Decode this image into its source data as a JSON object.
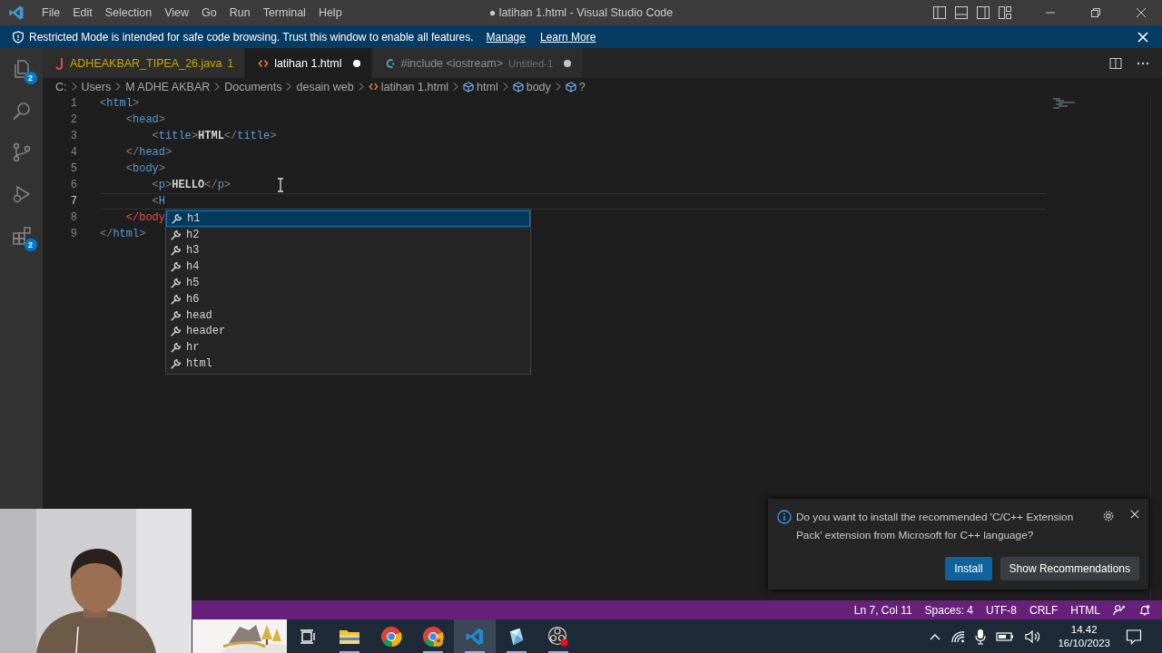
{
  "window": {
    "title": "● latihan 1.html - Visual Studio Code"
  },
  "menu": [
    "File",
    "Edit",
    "Selection",
    "View",
    "Go",
    "Run",
    "Terminal",
    "Help"
  ],
  "banner": {
    "text": "Restricted Mode is intended for safe code browsing. Trust this window to enable all features.",
    "links": [
      "Manage",
      "Learn More"
    ]
  },
  "activity_bar": [
    {
      "kind": "explorer",
      "badge": "2"
    },
    {
      "kind": "search"
    },
    {
      "kind": "source-control"
    },
    {
      "kind": "run"
    },
    {
      "kind": "extensions",
      "badge": "2"
    }
  ],
  "tabs": [
    {
      "kind": "java",
      "label": "ADHEAKBAR_TIPEA_26.java",
      "problems": "1",
      "selected": false,
      "dirty": false
    },
    {
      "kind": "html",
      "label": "latihan 1.html",
      "selected": true,
      "dirty": true
    },
    {
      "kind": "cpp",
      "label": "#include <iostream>",
      "description": "Untitled-1",
      "selected": false,
      "dirty": true
    }
  ],
  "breadcrumbs": [
    {
      "kind": "folder",
      "label": "C:"
    },
    {
      "kind": "folder",
      "label": "Users"
    },
    {
      "kind": "folder",
      "label": "M ADHE AKBAR"
    },
    {
      "kind": "folder",
      "label": "Documents"
    },
    {
      "kind": "folder",
      "label": "desain web"
    },
    {
      "kind": "file",
      "label": "latihan 1.html"
    },
    {
      "kind": "symbol",
      "label": "html"
    },
    {
      "kind": "symbol",
      "label": "body"
    },
    {
      "kind": "symbol",
      "label": "?"
    }
  ],
  "editor": {
    "lines": [
      {
        "number": "1",
        "current": false,
        "tokens": [
          {
            "kind": "punct",
            "text": "<"
          },
          {
            "kind": "tag",
            "text": "html"
          },
          {
            "kind": "punct",
            "text": ">"
          }
        ]
      },
      {
        "number": "2",
        "current": false,
        "tokens": [
          {
            "kind": "punct",
            "text": "    <"
          },
          {
            "kind": "tag",
            "text": "head"
          },
          {
            "kind": "punct",
            "text": ">"
          }
        ]
      },
      {
        "number": "3",
        "current": false,
        "tokens": [
          {
            "kind": "punct",
            "text": "        <"
          },
          {
            "kind": "tag",
            "text": "title"
          },
          {
            "kind": "punct",
            "text": ">"
          },
          {
            "kind": "text",
            "text": "HTML"
          },
          {
            "kind": "punct",
            "text": "</"
          },
          {
            "kind": "tag",
            "text": "title"
          },
          {
            "kind": "punct",
            "text": ">"
          }
        ]
      },
      {
        "number": "4",
        "current": false,
        "tokens": [
          {
            "kind": "punct",
            "text": "    </"
          },
          {
            "kind": "tag",
            "text": "head"
          },
          {
            "kind": "punct",
            "text": ">"
          }
        ]
      },
      {
        "number": "5",
        "current": false,
        "tokens": [
          {
            "kind": "punct",
            "text": "    <"
          },
          {
            "kind": "tag",
            "text": "body"
          },
          {
            "kind": "punct",
            "text": ">"
          }
        ]
      },
      {
        "number": "6",
        "current": false,
        "tokens": [
          {
            "kind": "punct",
            "text": "        <"
          },
          {
            "kind": "tag",
            "text": "p"
          },
          {
            "kind": "punct",
            "text": ">"
          },
          {
            "kind": "text",
            "text": "HELLO"
          },
          {
            "kind": "punct",
            "text": "</"
          },
          {
            "kind": "tag",
            "text": "p"
          },
          {
            "kind": "punct",
            "text": ">"
          }
        ]
      },
      {
        "number": "7",
        "current": true,
        "tokens": [
          {
            "kind": "punct",
            "text": "        <"
          },
          {
            "kind": "tag",
            "text": "H"
          }
        ]
      },
      {
        "number": "8",
        "current": false,
        "tokens": [
          {
            "kind": "error",
            "text": "    </body"
          }
        ]
      },
      {
        "number": "9",
        "current": false,
        "tokens": [
          {
            "kind": "punct",
            "text": "</"
          },
          {
            "kind": "tag",
            "text": "html"
          },
          {
            "kind": "punct",
            "text": ">"
          }
        ]
      }
    ],
    "suggestions": [
      {
        "label": "h1",
        "selected": true
      },
      {
        "label": "h2",
        "selected": false
      },
      {
        "label": "h3",
        "selected": false
      },
      {
        "label": "h4",
        "selected": false
      },
      {
        "label": "h5",
        "selected": false
      },
      {
        "label": "h6",
        "selected": false
      },
      {
        "label": "head",
        "selected": false
      },
      {
        "label": "header",
        "selected": false
      },
      {
        "label": "hr",
        "selected": false
      },
      {
        "label": "html",
        "selected": false
      }
    ]
  },
  "notification": {
    "message": "Do you want to install the recommended 'C/C++ Extension Pack' extension from Microsoft for C++ language?",
    "buttons": [
      {
        "label": "Install",
        "primary": true
      },
      {
        "label": "Show Recommendations",
        "primary": false
      }
    ]
  },
  "status_bar": [
    "Ln 7, Col 11",
    "Spaces: 4",
    "UTF-8",
    "CRLF",
    "HTML"
  ],
  "taskbar": {
    "apps": [
      {
        "kind": "task-view",
        "running": false,
        "active": false
      },
      {
        "kind": "folder",
        "running": true,
        "active": false
      },
      {
        "kind": "browser",
        "running": false,
        "active": false
      },
      {
        "kind": "browser-profile",
        "running": true,
        "active": false
      },
      {
        "kind": "editor",
        "running": true,
        "active": true
      },
      {
        "kind": "crystal",
        "running": true,
        "active": false
      },
      {
        "kind": "recorder",
        "running": true,
        "active": false
      }
    ],
    "time": "14.42",
    "date": "16/10/2023"
  }
}
